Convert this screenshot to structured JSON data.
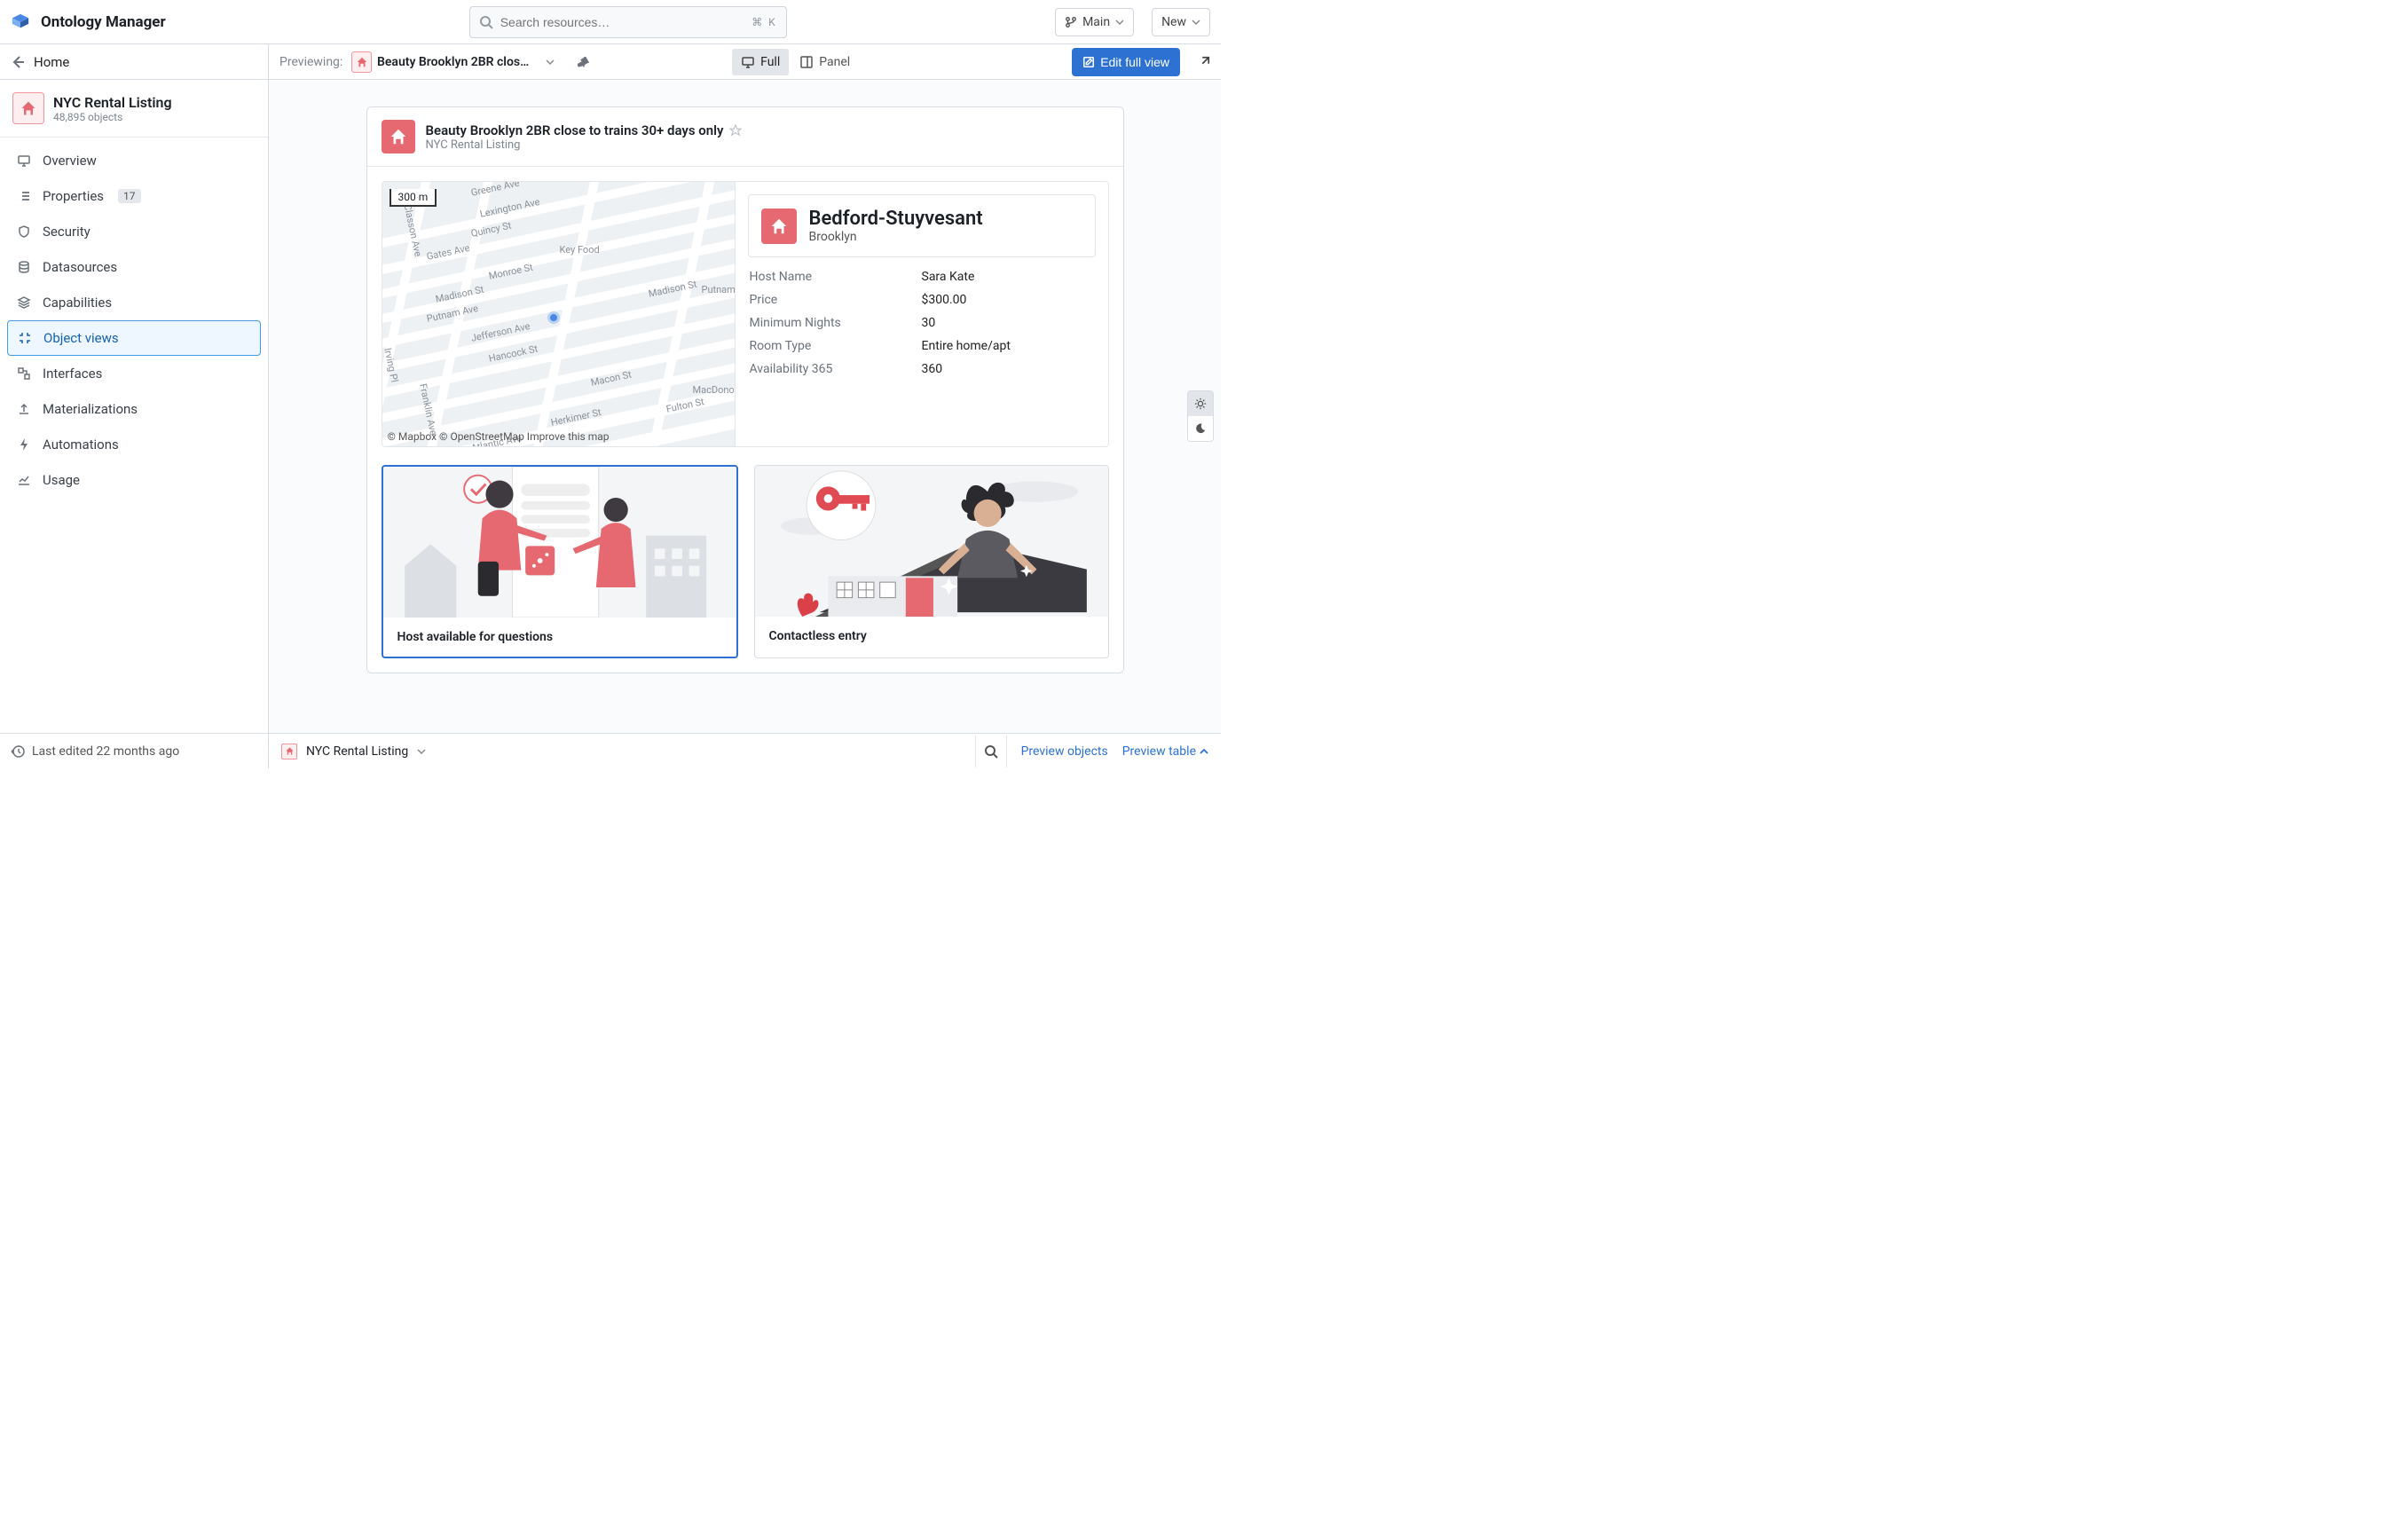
{
  "app": {
    "title": "Ontology Manager"
  },
  "search": {
    "placeholder": "Search resources…",
    "shortcut": "⌘ K"
  },
  "topbar": {
    "branch_label": "Main",
    "new_label": "New"
  },
  "breadcrumb": {
    "home": "Home"
  },
  "preview": {
    "label": "Previewing:",
    "object_name": "Beauty Brooklyn 2BR close …",
    "full_label": "Full",
    "panel_label": "Panel",
    "edit_label": "Edit full view"
  },
  "sidebar": {
    "title": "NYC Rental Listing",
    "subtitle": "48,895 objects",
    "items": [
      {
        "label": "Overview"
      },
      {
        "label": "Properties",
        "badge": "17"
      },
      {
        "label": "Security"
      },
      {
        "label": "Datasources"
      },
      {
        "label": "Capabilities"
      },
      {
        "label": "Object views"
      },
      {
        "label": "Interfaces"
      },
      {
        "label": "Materializations"
      },
      {
        "label": "Automations"
      },
      {
        "label": "Usage"
      }
    ]
  },
  "card": {
    "title": "Beauty Brooklyn 2BR close to trains 30+ days only",
    "subtitle": "NYC Rental Listing",
    "map": {
      "scale": "300 m",
      "attribution": "© Mapbox © OpenStreetMap Improve this map",
      "streets": [
        "Greene Ave",
        "Lexington Ave",
        "Quincy St",
        "Gates Ave",
        "Monroe St",
        "Madison St",
        "Putnam Ave",
        "Jefferson Ave",
        "Hancock St",
        "Macon St",
        "Fulton St",
        "Herkimer St",
        "Atlantic Ave",
        "Classon Ave",
        "Irving Pl",
        "Franklin Ave"
      ],
      "pois": [
        "Key Food",
        "Putnam",
        "MacDonough"
      ]
    },
    "info": {
      "neighborhood": "Bedford-Stuyvesant",
      "borough": "Brooklyn",
      "rows": [
        {
          "label": "Host Name",
          "value": "Sara Kate"
        },
        {
          "label": "Price",
          "value": "$300.00"
        },
        {
          "label": "Minimum Nights",
          "value": "30"
        },
        {
          "label": "Room Type",
          "value": "Entire home/apt"
        },
        {
          "label": "Availability 365",
          "value": "360"
        }
      ]
    },
    "features": [
      {
        "label": "Host available for questions"
      },
      {
        "label": "Contactless entry"
      }
    ]
  },
  "footer": {
    "last_edited": "Last edited 22 months ago",
    "object_label": "NYC Rental Listing",
    "preview_objects": "Preview objects",
    "preview_table": "Preview table"
  }
}
